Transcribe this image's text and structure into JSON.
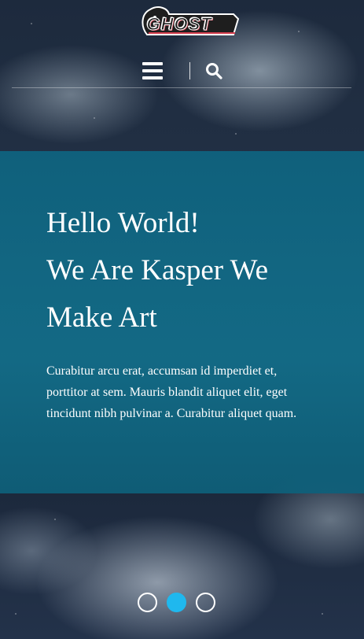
{
  "header": {
    "logo_text": "GHOST",
    "menu_icon": "hamburger-menu-icon",
    "search_icon": "search-icon"
  },
  "hero": {
    "title_lines": [
      "Hello World!",
      "We Are Kasper We",
      "Make Art"
    ],
    "body": "Curabitur arcu erat, accumsan id imperdiet et, porttitor at sem. Mauris blandit aliquet elit, eget tincidunt nibh pulvinar a. Curabitur aliquet quam."
  },
  "pagination": {
    "count": 3,
    "active_index": 1
  },
  "colors": {
    "overlay": "#0f6a86",
    "accent": "#1fb8ee",
    "text": "#ffffff",
    "logo_outline": "#d43d4d"
  }
}
